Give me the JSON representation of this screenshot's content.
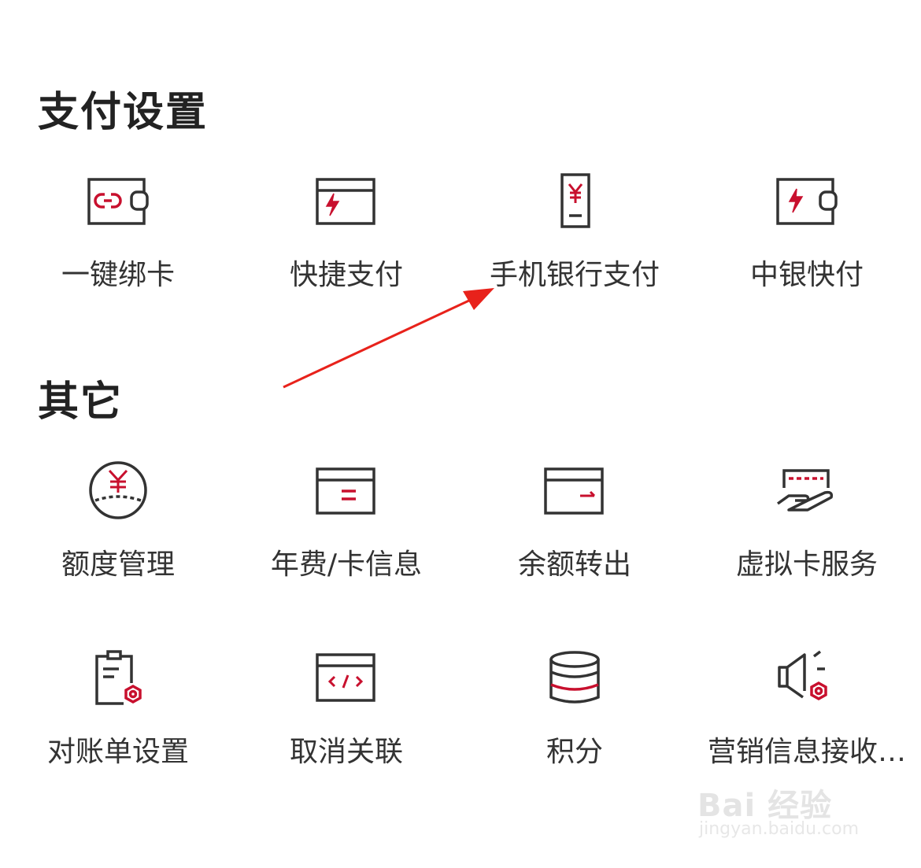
{
  "sections": {
    "payment_settings": {
      "title": "支付设置",
      "items": [
        {
          "label": "一键绑卡",
          "icon": "wallet-link-icon"
        },
        {
          "label": "快捷支付",
          "icon": "card-lightning-icon"
        },
        {
          "label": "手机银行支付",
          "icon": "phone-yuan-icon"
        },
        {
          "label": "中银快付",
          "icon": "wallet-lightning-icon"
        }
      ]
    },
    "other": {
      "title": "其它",
      "items": [
        {
          "label": "额度管理",
          "icon": "yuan-circle-icon"
        },
        {
          "label": "年费/卡信息",
          "icon": "card-info-icon"
        },
        {
          "label": "余额转出",
          "icon": "card-transfer-icon"
        },
        {
          "label": "虚拟卡服务",
          "icon": "hand-card-icon"
        },
        {
          "label": "对账单设置",
          "icon": "clipboard-gear-icon"
        },
        {
          "label": "取消关联",
          "icon": "card-code-icon"
        },
        {
          "label": "积分",
          "icon": "database-icon"
        },
        {
          "label": "营销信息接收…",
          "icon": "speaker-gear-icon"
        }
      ]
    }
  },
  "watermark": {
    "brand": "Bai 经验",
    "url": "jingyan.baidu.com"
  },
  "colors": {
    "accent": "#c8102e",
    "icon_stroke": "#333333",
    "text": "#333333"
  }
}
